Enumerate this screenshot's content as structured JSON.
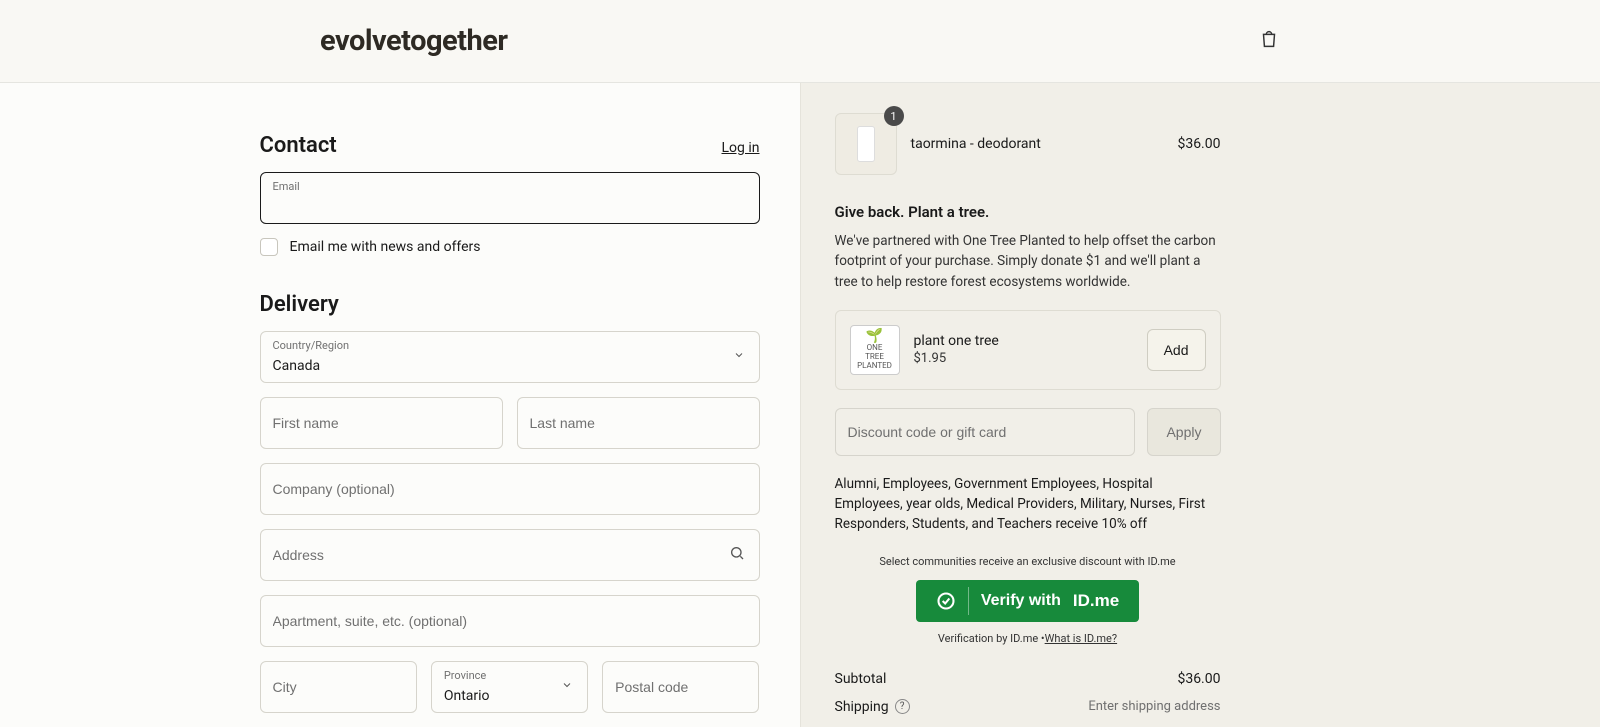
{
  "header": {
    "logo": "evolvetogether"
  },
  "contact": {
    "heading": "Contact",
    "login": "Log in",
    "email_label": "Email",
    "news_checkbox_label": "Email me with news and offers"
  },
  "delivery": {
    "heading": "Delivery",
    "country_label": "Country/Region",
    "country_value": "Canada",
    "first_name_placeholder": "First name",
    "last_name_placeholder": "Last name",
    "company_placeholder": "Company (optional)",
    "address_placeholder": "Address",
    "apt_placeholder": "Apartment, suite, etc. (optional)",
    "city_placeholder": "City",
    "province_label": "Province",
    "province_value": "Ontario",
    "postal_placeholder": "Postal code"
  },
  "cart": {
    "items": [
      {
        "name": "taormina - deodorant",
        "qty": "1",
        "price": "$36.00"
      }
    ]
  },
  "giveback": {
    "title": "Give back. Plant a tree.",
    "text": "We've partnered with One Tree Planted to help offset the carbon footprint of your purchase. Simply donate $1 and we'll plant a tree to help restore forest ecosystems worldwide.",
    "addon_name": "plant one tree",
    "addon_price": "$1.95",
    "addon_thumb_line1": "ONE",
    "addon_thumb_line2": "TREE",
    "addon_thumb_line3": "PLANTED",
    "add_label": "Add"
  },
  "discount": {
    "placeholder": "Discount code or gift card",
    "apply_label": "Apply",
    "note": "Alumni, Employees, Government Employees, Hospital Employees, year olds, Medical Providers, Military, Nurses, First Responders, Students, and Teachers receive 10% off"
  },
  "idme": {
    "line1": "Select communities receive an exclusive discount with ID.me",
    "verify_text": "Verify with",
    "brand": "ID.me",
    "line2_prefix": "Verification by ID.me •",
    "line2_link": "What is ID.me?"
  },
  "totals": {
    "subtotal_label": "Subtotal",
    "subtotal_value": "$36.00",
    "shipping_label": "Shipping",
    "shipping_value": "Enter shipping address"
  }
}
